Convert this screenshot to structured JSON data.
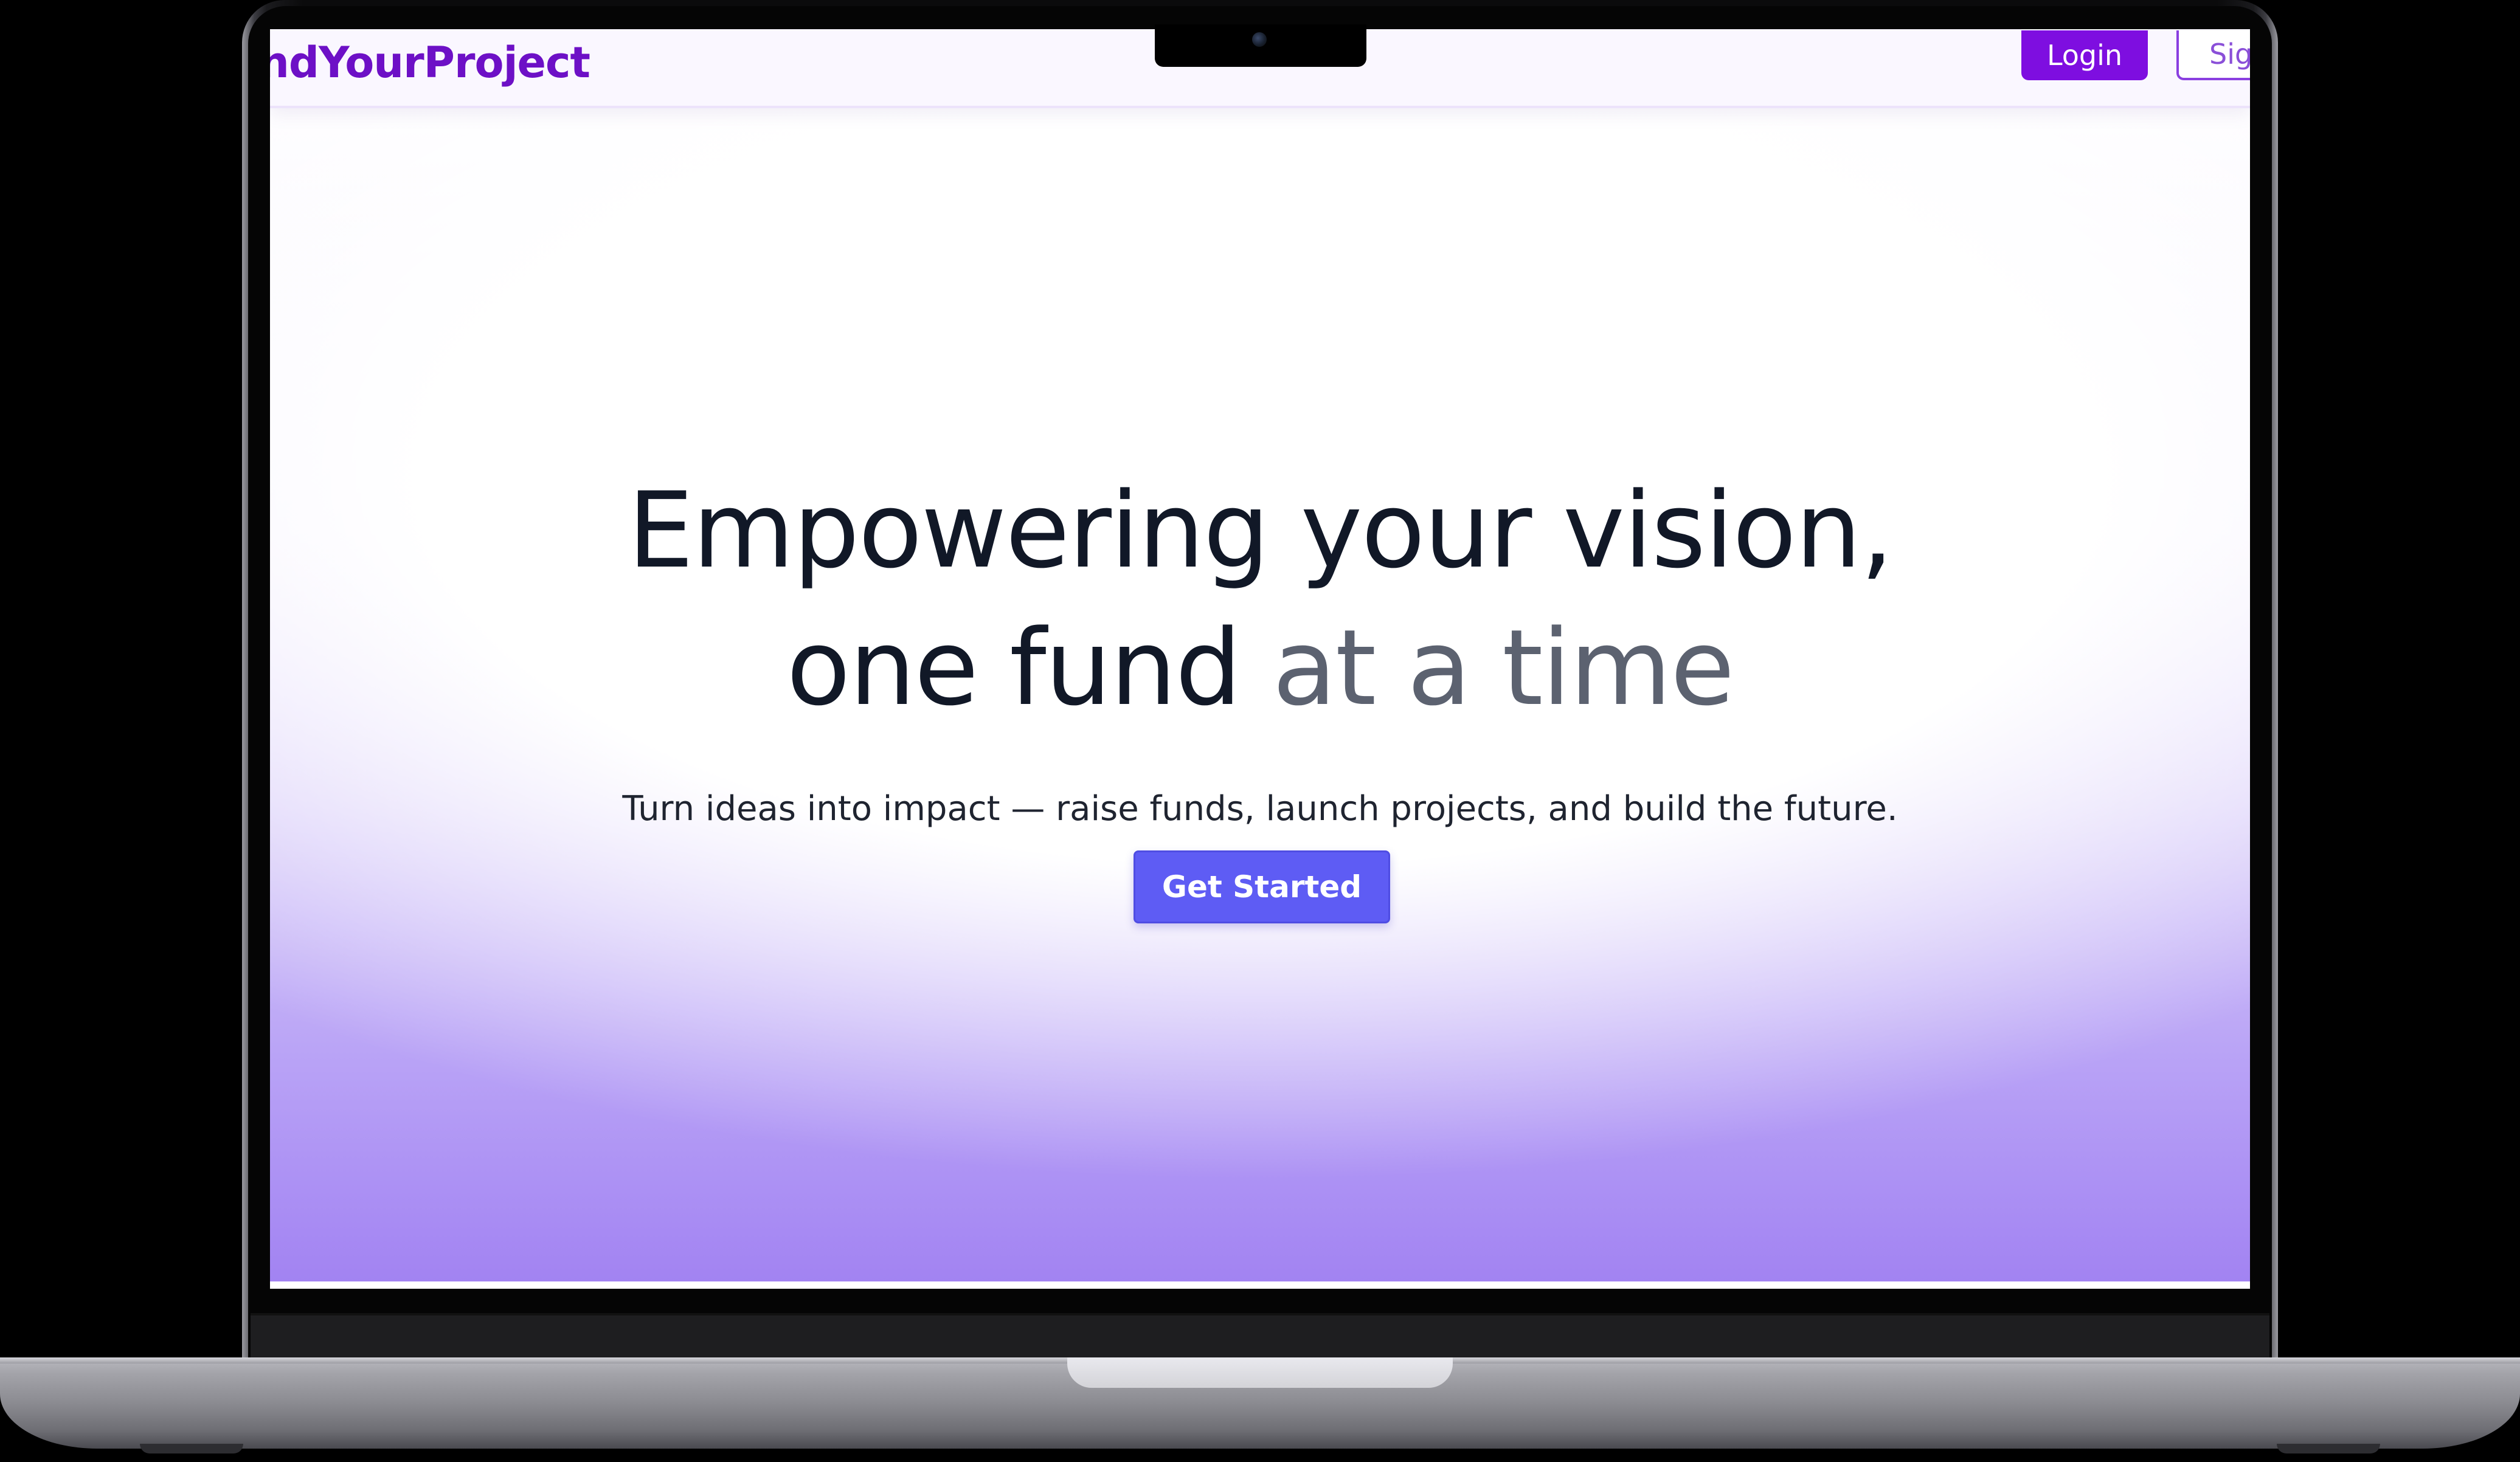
{
  "navbar": {
    "brand": "ndYourProject",
    "login_label": "Login",
    "signup_label": "Sig"
  },
  "hero": {
    "title_line1": "Empowering your vision,",
    "title_line2_a": "one fund ",
    "title_line2_b": "at a time",
    "subtitle": "Turn ideas into impact — raise funds, launch projects, and build the future.",
    "cta_label": "Get Started"
  },
  "colors": {
    "brand": "#6d10c6",
    "login_button": "#7e0ee0",
    "cta_button": "#5e5cf4",
    "title_text": "#111827",
    "title_muted": "#5c6270",
    "gradient_bottom": "#a283f2"
  }
}
